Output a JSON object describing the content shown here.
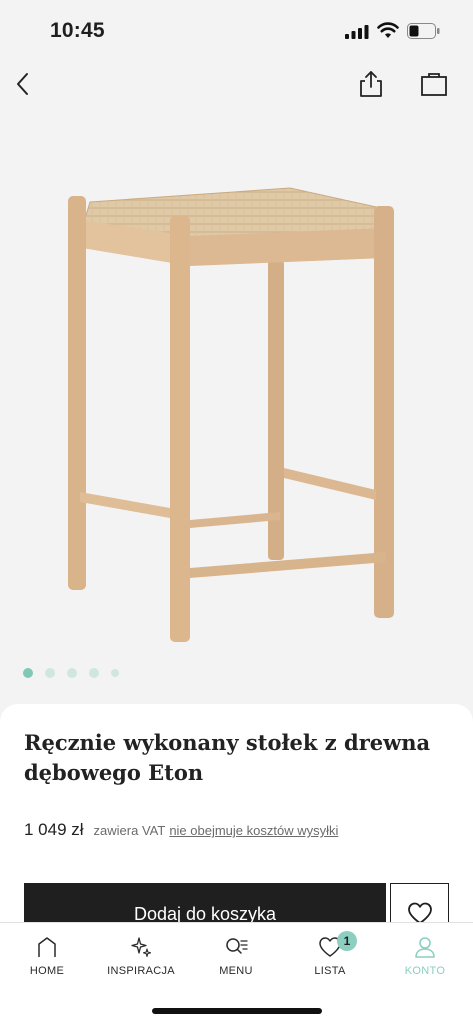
{
  "status_bar": {
    "time": "10:45"
  },
  "product": {
    "title": "Ręcznie wykonany stołek z drewna dębowego Eton",
    "price": "1 049 zł",
    "vat_text": "zawiera VAT",
    "shipping_link": "nie obejmuje kosztów wysyłki",
    "add_to_cart": "Dodaj do koszyka"
  },
  "carousel": {
    "count": 5,
    "active": 0
  },
  "tabbar": {
    "items": [
      {
        "label": "HOME",
        "icon": "home-icon"
      },
      {
        "label": "INSPIRACJA",
        "icon": "sparkles-icon"
      },
      {
        "label": "MENU",
        "icon": "menu-search-icon"
      },
      {
        "label": "LISTA",
        "icon": "heart-icon",
        "badge": "1"
      },
      {
        "label": "KONTO",
        "icon": "user-icon",
        "active": true
      }
    ]
  },
  "colors": {
    "accent": "#8ccfc0",
    "button": "#1f1f1f",
    "background": "#f4f3f3"
  }
}
